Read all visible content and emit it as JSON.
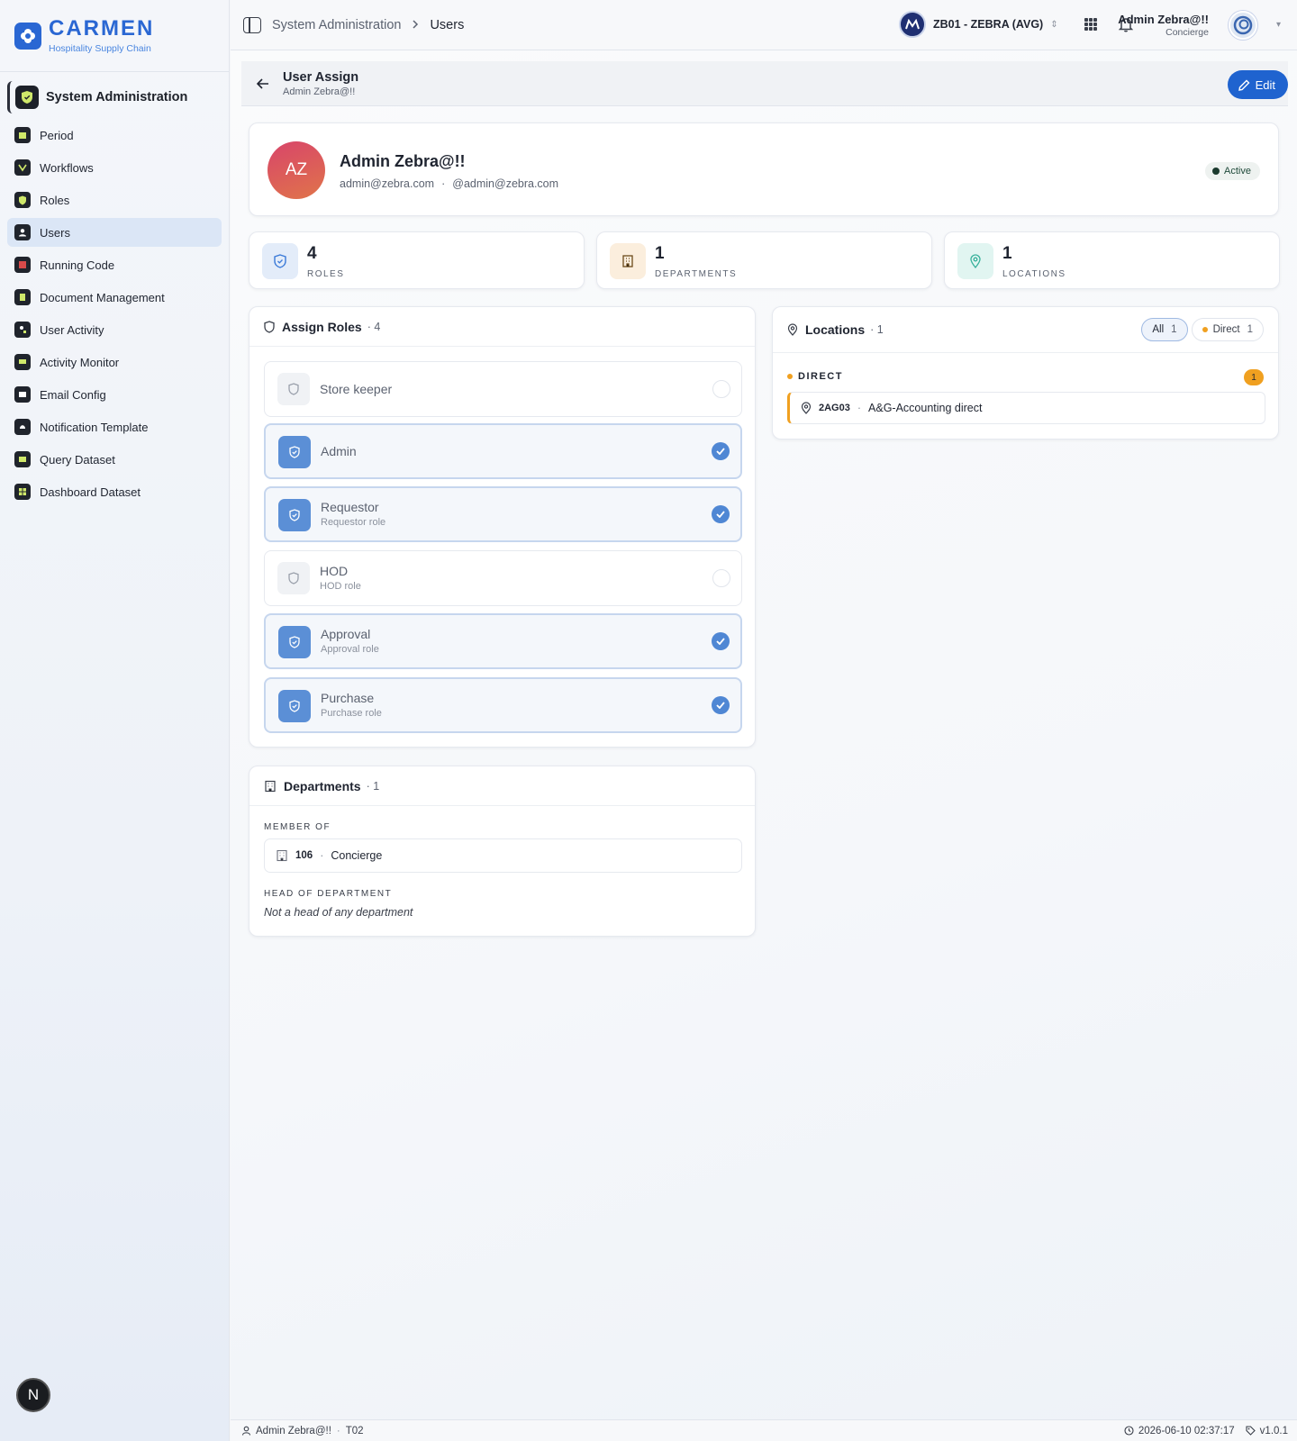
{
  "brand": {
    "name": "CARMEN",
    "tagline": "Hospitality Supply Chain"
  },
  "module": {
    "title": "System Administration"
  },
  "nav": {
    "items": [
      {
        "label": "Period",
        "icon": "calendar-icon"
      },
      {
        "label": "Workflows",
        "icon": "workflow-icon"
      },
      {
        "label": "Roles",
        "icon": "shield-icon"
      },
      {
        "label": "Users",
        "icon": "user-icon",
        "active": true
      },
      {
        "label": "Running Code",
        "icon": "code-icon"
      },
      {
        "label": "Document Management",
        "icon": "document-icon"
      },
      {
        "label": "User Activity",
        "icon": "user-activity-icon"
      },
      {
        "label": "Activity Monitor",
        "icon": "monitor-icon"
      },
      {
        "label": "Email Config",
        "icon": "mail-icon"
      },
      {
        "label": "Notification Template",
        "icon": "bell-icon"
      },
      {
        "label": "Query Dataset",
        "icon": "dataset-icon"
      },
      {
        "label": "Dashboard Dataset",
        "icon": "dashboard-icon"
      }
    ]
  },
  "sidebar_badge": "N",
  "topbar": {
    "breadcrumb": [
      "System Administration",
      "Users"
    ],
    "business_unit": "ZB01 - ZEBRA (AVG)",
    "user_name": "Admin Zebra@!!",
    "user_department": "Concierge"
  },
  "subheader": {
    "title": "User Assign",
    "subtitle": "Admin Zebra@!!",
    "edit_label": "Edit"
  },
  "profile": {
    "initials": "AZ",
    "name": "Admin Zebra@!!",
    "email": "admin@zebra.com",
    "separator": "·",
    "username": "@admin@zebra.com",
    "status": "Active"
  },
  "stats": [
    {
      "value": "4",
      "label": "ROLES"
    },
    {
      "value": "1",
      "label": "DEPARTMENTS"
    },
    {
      "value": "1",
      "label": "LOCATIONS"
    }
  ],
  "roles": {
    "title": "Assign Roles",
    "count": "· 4",
    "items": [
      {
        "name": "Store keeper",
        "description": "",
        "selected": false
      },
      {
        "name": "Admin",
        "description": "",
        "selected": true
      },
      {
        "name": "Requestor",
        "description": "Requestor role",
        "selected": true
      },
      {
        "name": "HOD",
        "description": "HOD role",
        "selected": false
      },
      {
        "name": "Approval",
        "description": "Approval role",
        "selected": true
      },
      {
        "name": "Purchase",
        "description": "Purchase role",
        "selected": true
      }
    ]
  },
  "departments": {
    "title": "Departments",
    "count": "· 1",
    "member_label": "MEMBER OF",
    "member_code": "106",
    "member_name": "Concierge",
    "head_label": "HEAD OF DEPARTMENT",
    "head_value": "Not a head of any department"
  },
  "locations": {
    "title": "Locations",
    "count": "· 1",
    "filter_all": "All",
    "filter_all_count": "1",
    "filter_direct": "Direct",
    "filter_direct_count": "1",
    "group_label": "DIRECT",
    "group_count": "1",
    "item_code": "2AG03",
    "item_name": "A&G-Accounting direct"
  },
  "footer": {
    "user": "Admin Zebra@!!",
    "tenant": "T02",
    "timestamp": "2026-06-10 02:37:17",
    "version": "v1.0.1"
  },
  "colors": {
    "accent": "#1f63cf",
    "selected_role": "#5b8fd6",
    "direct": "#f0a020"
  }
}
